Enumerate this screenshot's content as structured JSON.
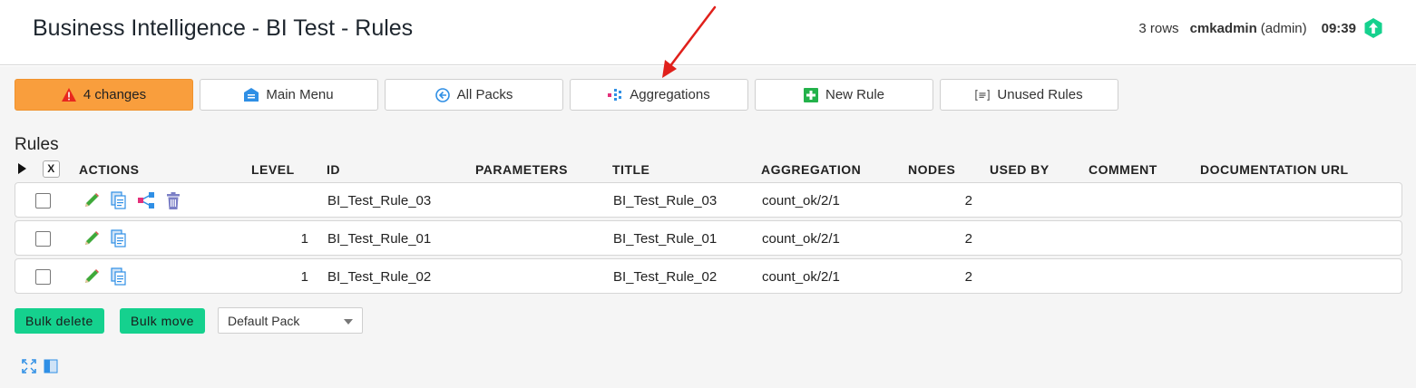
{
  "header": {
    "title": "Business Intelligence - BI Test - Rules",
    "rows": "3 rows",
    "user": "cmkadmin",
    "role": "(admin)",
    "time": "09:39"
  },
  "toolbar": {
    "changes": "4 changes",
    "main_menu": "Main Menu",
    "all_packs": "All Packs",
    "aggregations": "Aggregations",
    "new_rule": "New Rule",
    "unused_rules": "Unused Rules"
  },
  "section_title": "Rules",
  "table": {
    "toggle_all": "X",
    "columns": [
      "ACTIONS",
      "LEVEL",
      "ID",
      "PARAMETERS",
      "TITLE",
      "AGGREGATION",
      "NODES",
      "USED BY",
      "COMMENT",
      "DOCUMENTATION URL"
    ],
    "rows": [
      {
        "level": "",
        "id": "BI_Test_Rule_03",
        "parameters": "",
        "title": "BI_Test_Rule_03",
        "aggregation": "count_ok/2/1",
        "nodes": "2",
        "used_by": "",
        "comment": "",
        "doc_url": "",
        "actions": [
          "edit-icon",
          "clone-icon",
          "tree-icon",
          "delete-icon"
        ]
      },
      {
        "level": "1",
        "id": "BI_Test_Rule_01",
        "parameters": "",
        "title": "BI_Test_Rule_01",
        "aggregation": "count_ok/2/1",
        "nodes": "2",
        "used_by": "",
        "comment": "",
        "doc_url": "",
        "actions": [
          "edit-icon",
          "clone-icon"
        ]
      },
      {
        "level": "1",
        "id": "BI_Test_Rule_02",
        "parameters": "",
        "title": "BI_Test_Rule_02",
        "aggregation": "count_ok/2/1",
        "nodes": "2",
        "used_by": "",
        "comment": "",
        "doc_url": "",
        "actions": [
          "edit-icon",
          "clone-icon"
        ]
      }
    ]
  },
  "bulk": {
    "delete": "Bulk delete",
    "move": "Bulk move",
    "pack_selected": "Default Pack"
  },
  "colors": {
    "changes_bg": "#f99e3d",
    "bulk_bg": "#15d18e",
    "annotation_arrow": "#e0201b"
  }
}
